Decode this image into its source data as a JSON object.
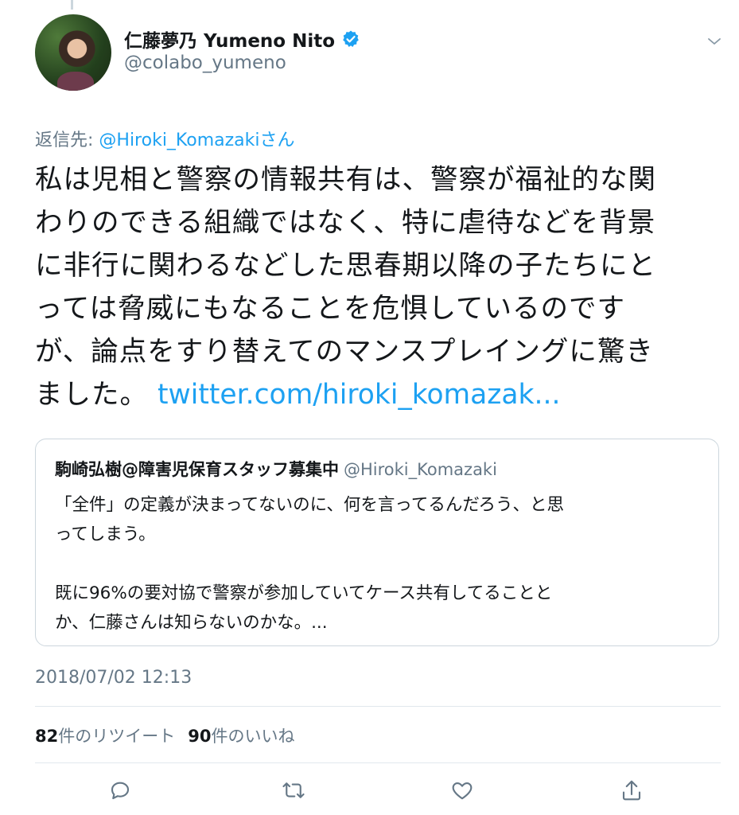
{
  "author": {
    "display_name": "仁藤夢乃  Yumeno Nito",
    "handle": "@colabo_yumeno"
  },
  "reply_to": {
    "prefix": "返信先: ",
    "mention": "@Hiroki_Komazakiさん"
  },
  "tweet": {
    "lines": [
      "私は児相と警察の情報共有は、警察が福祉的な関",
      "わりのできる組織ではなく、特に虐待などを背景",
      "に非行に関わるなどした思春期以降の子たちにと",
      "っては脅威にもなることを危惧しているのです",
      "が、論点をすり替えてのマンスプレイングに驚き",
      "ました。"
    ],
    "link": "twitter.com/hiroki_komazak..."
  },
  "quote": {
    "name": "駒崎弘樹@障害児保育スタッフ募集中",
    "handle": "@Hiroki_Komazaki",
    "lines": [
      "「全件」の定義が決まってないのに、何を言ってるんだろう、と思",
      "ってしまう。",
      "既に96%の要対協で警察が参加していてケース共有してることと",
      "か、仁藤さんは知らないのかな。..."
    ]
  },
  "timestamp": "2018/07/02 12:13",
  "stats": {
    "retweets_count": "82",
    "retweets_label": "件のリツイート",
    "likes_count": "90",
    "likes_label": "件のいいね"
  },
  "colors": {
    "link": "#1da1f2",
    "secondary_text": "#657786",
    "primary_text": "#14171a",
    "border": "#e1e8ed"
  },
  "icons": {
    "verified": "verified-badge-icon",
    "caret": "chevron-down-icon",
    "reply": "reply-icon",
    "retweet": "retweet-icon",
    "like": "heart-icon",
    "share": "share-icon"
  }
}
